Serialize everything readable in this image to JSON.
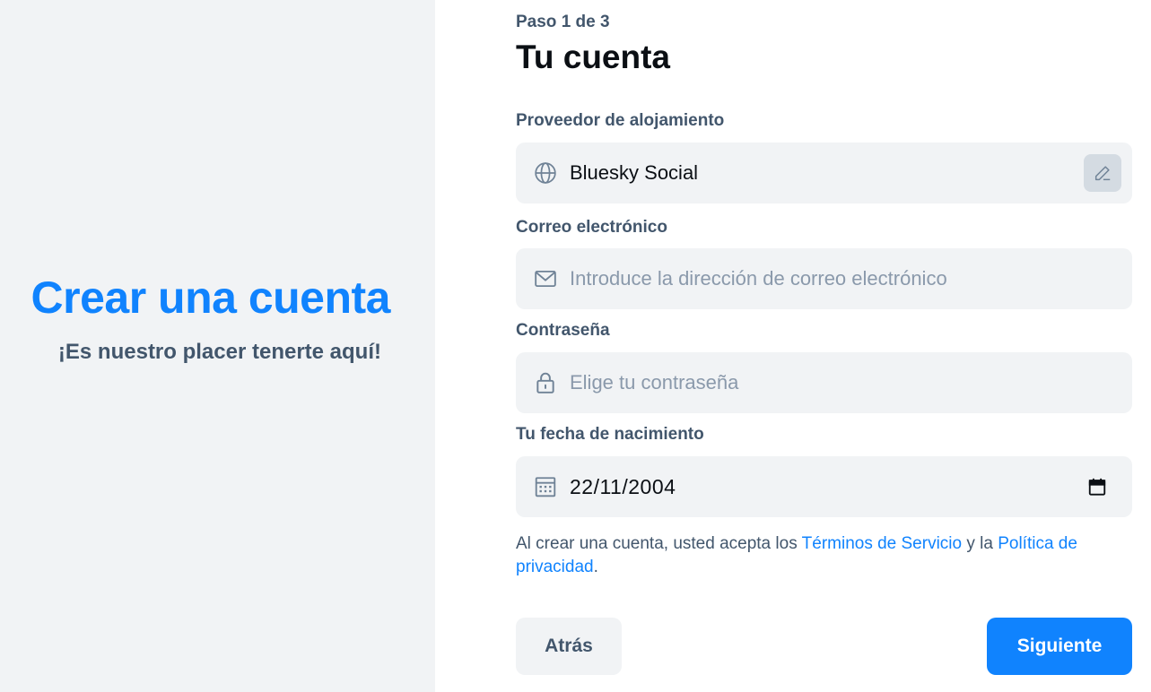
{
  "hero": {
    "title": "Crear una cuenta",
    "subtitle": "¡Es nuestro placer tenerte aquí!"
  },
  "form": {
    "step": "Paso 1 de 3",
    "title": "Tu cuenta",
    "hosting": {
      "label": "Proveedor de alojamiento",
      "value": "Bluesky Social",
      "icon": "globe-icon",
      "edit_icon": "pencil-icon"
    },
    "email": {
      "label": "Correo electrónico",
      "placeholder": "Introduce la dirección de correo electrónico",
      "value": "",
      "icon": "envelope-icon"
    },
    "password": {
      "label": "Contraseña",
      "placeholder": "Elige tu contraseña",
      "value": "",
      "icon": "lock-icon"
    },
    "birthdate": {
      "label": "Tu fecha de nacimiento",
      "value": "22/11/2004",
      "icon": "calendar-icon",
      "picker_icon": "calendar-picker-icon"
    },
    "terms": {
      "prefix": "Al crear una cuenta, usted acepta los ",
      "tos_link": "Términos de Servicio",
      "middle": " y la ",
      "privacy_link": "Política de privacidad",
      "suffix": "."
    },
    "buttons": {
      "back": "Atrás",
      "next": "Siguiente"
    }
  },
  "colors": {
    "accent": "#1083fe",
    "muted_text": "#42566c",
    "panel_bg": "#f1f3f5",
    "placeholder": "#8a99ab"
  }
}
